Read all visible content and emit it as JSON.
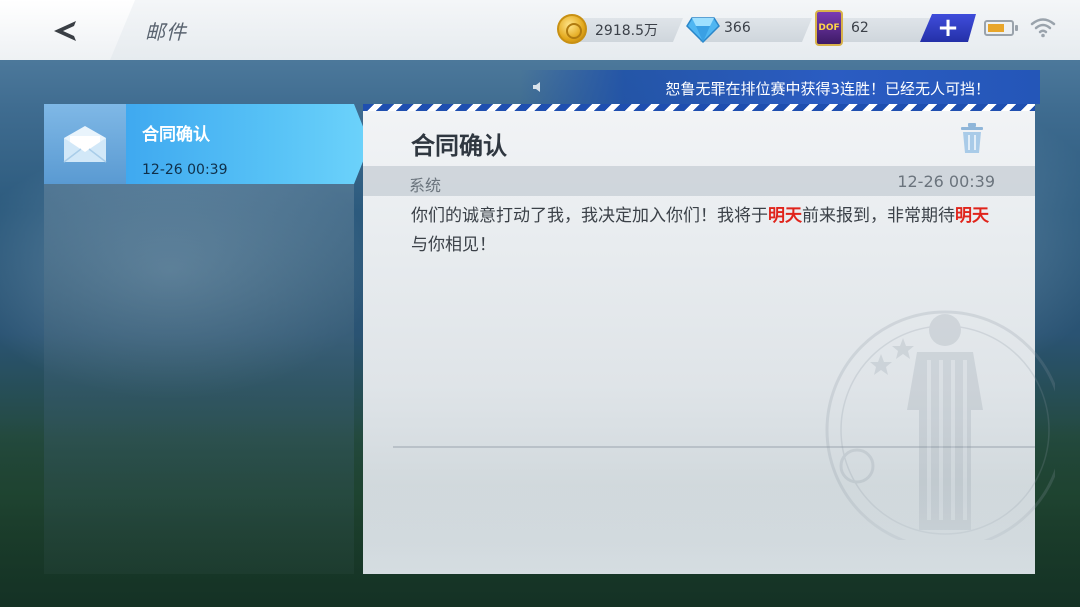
{
  "header": {
    "title": "邮件",
    "back_icon": "back-arrow-icon"
  },
  "resources": {
    "coins": "2918.5万",
    "diamonds": "366",
    "cards": "62",
    "card_label": "DOF"
  },
  "status": {
    "battery_level": 0.55
  },
  "notice": {
    "text": "恕鲁无罪在排位赛中获得3连胜！已经无人可挡！"
  },
  "mail_list": [
    {
      "title": "合同确认",
      "date": "12-26 00:39"
    }
  ],
  "mail_detail": {
    "subject": "合同确认",
    "sender": "系统",
    "time": "12-26 00:39",
    "body": {
      "p1": "你们的诚意打动了我，我决定加入你们！我将于",
      "hl1": "明天",
      "p2": "前来报到，非常期待",
      "hl2": "明天",
      "p3": "与你相见！"
    }
  },
  "colors": {
    "accent": "#57c2f6",
    "highlight": "#e0241b",
    "plus_button": "#2f3ec4",
    "banner": "#2b5cc2"
  }
}
